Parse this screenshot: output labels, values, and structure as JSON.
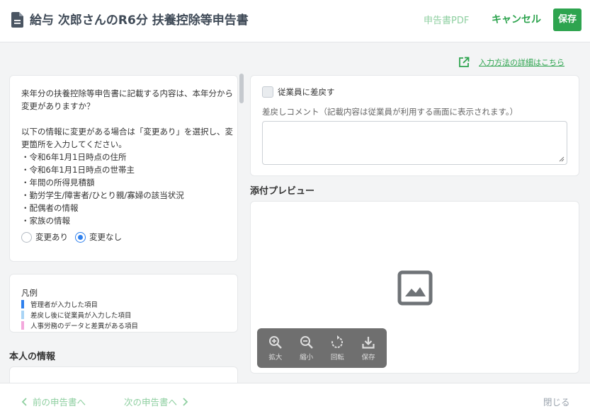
{
  "header": {
    "title": "給与 次郎さんのR6分 扶養控除等申告書",
    "pdf_label": "申告書PDF",
    "cancel_label": "キャンセル",
    "save_label": "保存"
  },
  "help_link": "入力方法の詳細はこちら",
  "question": {
    "line1": "来年分の扶養控除等申告書に記載する内容は、本年分から変更がありますか？",
    "line2": "以下の情報に変更がある場合は「変更あり」を選択し、変更箇所を入力してください。",
    "items": [
      "・令和6年1月1日時点の住所",
      "・令和6年1月1日時点の世帯主",
      "・年間の所得見積額",
      "・勤労学生/障害者/ひとり親/寡婦の該当状況",
      "・配偶者の情報",
      "・家族の情報"
    ],
    "options": [
      {
        "label": "変更あり",
        "selected": false
      },
      {
        "label": "変更なし",
        "selected": true
      }
    ]
  },
  "legend": {
    "title": "凡例",
    "items": [
      {
        "label": "管理者が入力した項目",
        "color": "#2f80ed"
      },
      {
        "label": "差戻し後に従業員が入力した項目",
        "color": "#a9d4f5"
      },
      {
        "label": "人事労務のデータと差異がある項目",
        "color": "#f3a8dc"
      }
    ]
  },
  "section_title": "本人の情報",
  "return_panel": {
    "checkbox_label": "従業員に差戻す",
    "comment_label": "差戻しコメント（記載内容は従業員が利用する画面に表示されます。）",
    "comment_value": ""
  },
  "preview": {
    "title": "添付プレビュー",
    "tools": [
      {
        "label": "拡大",
        "icon": "zoom-in-icon"
      },
      {
        "label": "縮小",
        "icon": "zoom-out-icon"
      },
      {
        "label": "回転",
        "icon": "rotate-icon"
      },
      {
        "label": "保存",
        "icon": "download-icon"
      }
    ]
  },
  "footer": {
    "prev_label": "前の申告書へ",
    "next_label": "次の申告書へ",
    "close_label": "閉じる"
  },
  "colors": {
    "accent": "#2ea44f",
    "accent_light": "#8ecfa0",
    "radio_selected": "#2f80ed"
  }
}
